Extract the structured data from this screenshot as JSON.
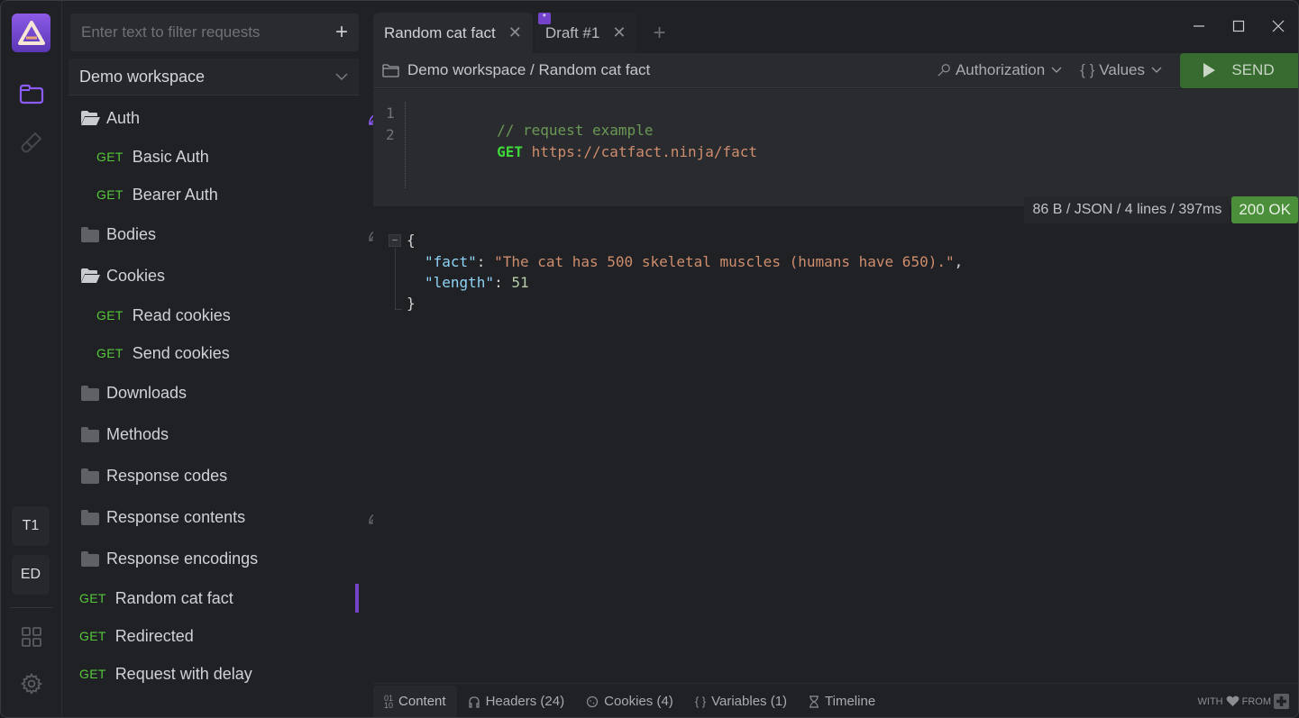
{
  "app": {
    "accent": "#7344c9",
    "success": "#4b8f3b",
    "method_color": "#56c83a"
  },
  "rail": {
    "users": [
      "T1",
      "ED"
    ]
  },
  "sidebar": {
    "filter_placeholder": "Enter text to filter requests",
    "workspace": "Demo workspace",
    "items": [
      {
        "type": "folder",
        "open": true,
        "label": "Auth",
        "icon_right": "leaf-icon-purple"
      },
      {
        "type": "request",
        "method": "GET",
        "label": "Basic Auth",
        "icon_right": "key-icon"
      },
      {
        "type": "request",
        "method": "GET",
        "label": "Bearer Auth"
      },
      {
        "type": "folder",
        "open": false,
        "label": "Bodies",
        "icon_right": "leaf-icon-gray"
      },
      {
        "type": "folder",
        "open": true,
        "label": "Cookies"
      },
      {
        "type": "request",
        "method": "GET",
        "label": "Read cookies"
      },
      {
        "type": "request",
        "method": "GET",
        "label": "Send cookies"
      },
      {
        "type": "folder",
        "open": false,
        "label": "Downloads"
      },
      {
        "type": "folder",
        "open": false,
        "label": "Methods"
      },
      {
        "type": "folder",
        "open": false,
        "label": "Response codes"
      },
      {
        "type": "folder",
        "open": false,
        "label": "Response contents",
        "icon_right": "leaf-icon-gray"
      },
      {
        "type": "folder",
        "open": false,
        "label": "Response encodings"
      },
      {
        "type": "request",
        "method": "GET",
        "label": "Random cat fact",
        "active": true
      },
      {
        "type": "request",
        "method": "GET",
        "label": "Redirected"
      },
      {
        "type": "request",
        "method": "GET",
        "label": "Request with delay"
      }
    ]
  },
  "tabs": [
    {
      "label": "Random cat fact",
      "active": true
    },
    {
      "label": "Draft #1",
      "badge": "*"
    }
  ],
  "request": {
    "breadcrumb": "Demo workspace / Random cat fact",
    "authorization_label": "Authorization",
    "values_label": "Values",
    "send_label": "SEND",
    "lines": [
      {
        "n": "1",
        "comment": "// request example"
      },
      {
        "n": "2",
        "method": "GET",
        "url": "https://catfact.ninja/fact"
      }
    ]
  },
  "response": {
    "info": "86 B / JSON / 4 lines / 397ms",
    "status": "200 OK",
    "open_brace": "{",
    "close_brace": "}",
    "fact_key": "\"fact\"",
    "fact_value": "\"The cat has 500 skeletal muscles (humans have 650).\"",
    "length_key": "\"length\"",
    "length_value": "51"
  },
  "bottom_tabs": [
    {
      "label": "Content",
      "active": true
    },
    {
      "label": "Headers (24)"
    },
    {
      "label": "Cookies (4)"
    },
    {
      "label": "Variables (1)"
    },
    {
      "label": "Timeline"
    }
  ],
  "credit": {
    "with": "WITH",
    "from": "FROM"
  }
}
